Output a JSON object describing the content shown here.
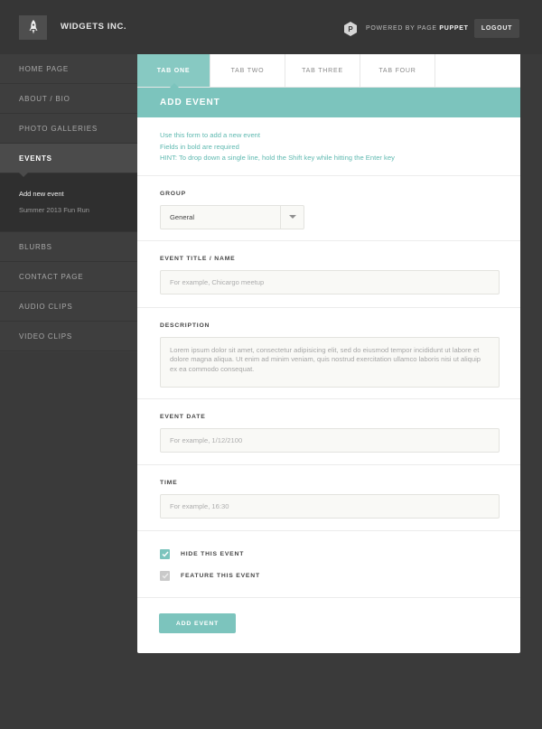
{
  "header": {
    "brand": "WIDGETS INC.",
    "powered_prefix": "POWERED BY PAGE ",
    "powered_bold": "PUPPET",
    "logout_label": "LOGOUT"
  },
  "sidebar": {
    "items": [
      {
        "label": "HOME PAGE"
      },
      {
        "label": "ABOUT / BIO"
      },
      {
        "label": "PHOTO GALLERIES"
      },
      {
        "label": "EVENTS"
      },
      {
        "label": "BLURBS"
      },
      {
        "label": "CONTACT PAGE"
      },
      {
        "label": "AUDIO CLIPS"
      },
      {
        "label": "VIDEO CLIPS"
      }
    ],
    "active_index": 3,
    "subitems": [
      {
        "label": "Add new event"
      },
      {
        "label": "Summer 2013 Fun Run"
      }
    ]
  },
  "tabs": [
    {
      "label": "TAB ONE"
    },
    {
      "label": "TAB TWO"
    },
    {
      "label": "TAB THREE"
    },
    {
      "label": "TAB FOUR"
    }
  ],
  "panel": {
    "title": "ADD EVENT",
    "intro": [
      "Use this form to add a new event",
      "Fields in bold are required",
      "HINT: To drop down a single line, hold the Shift key while hitting the Enter key"
    ]
  },
  "form": {
    "group": {
      "label": "GROUP",
      "value": "General"
    },
    "title": {
      "label": "EVENT TITLE / NAME",
      "placeholder": "For example, Chicargo meetup"
    },
    "description": {
      "label": "DESCRIPTION",
      "value": "Lorem ipsum dolor sit amet, consectetur adipisicing elit, sed do eiusmod tempor incididunt ut labore et dolore magna aliqua. Ut enim ad minim veniam, quis nostrud exercitation ullamco laboris nisi ut aliquip ex ea commodo consequat."
    },
    "date": {
      "label": "EVENT DATE",
      "placeholder": "For example, 1/12/2100"
    },
    "time": {
      "label": "TIME",
      "placeholder": "For example, 16:30"
    },
    "checkboxes": [
      {
        "label": "HIDE THIS EVENT",
        "checked": true
      },
      {
        "label": "FEATURE THIS EVENT",
        "checked": false
      }
    ],
    "submit_label": "ADD EVENT"
  },
  "colors": {
    "accent": "#7cc4bd",
    "accent_text": "#5fb9b0",
    "header_bg": "#363636",
    "sidebar_bg": "#3e3e3e",
    "page_bg": "#3a3a3a"
  }
}
